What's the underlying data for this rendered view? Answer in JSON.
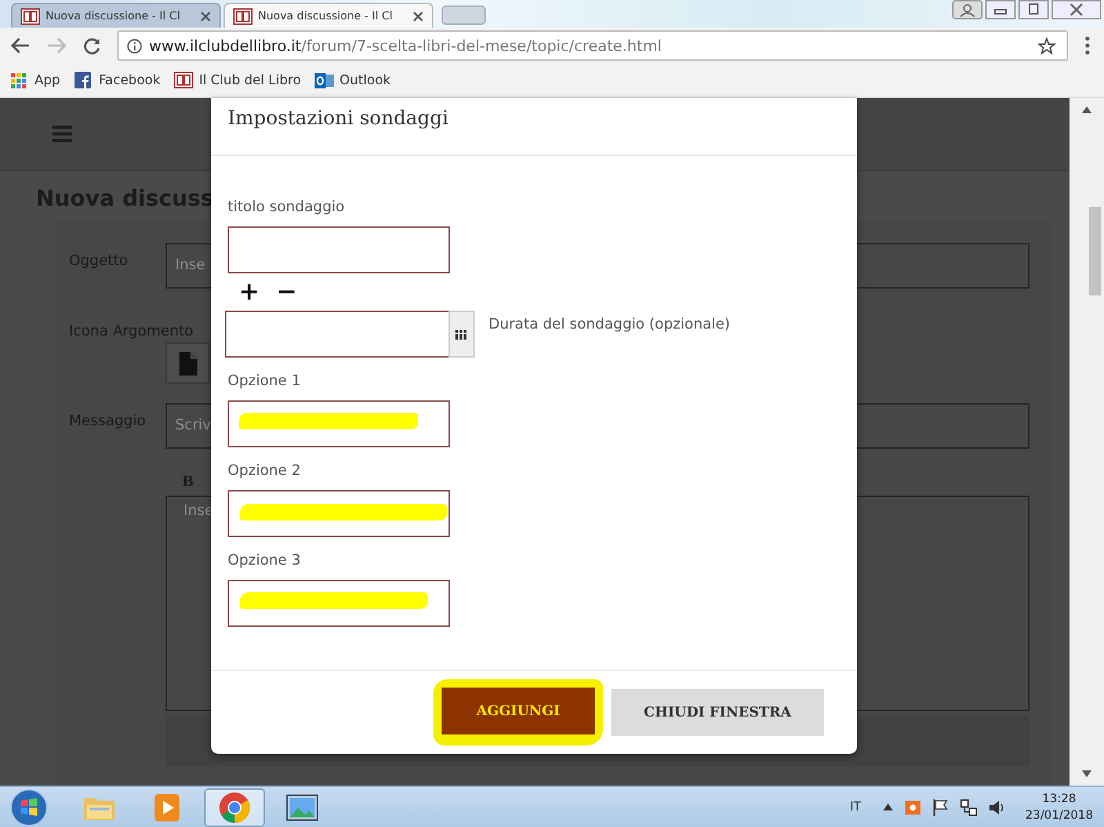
{
  "browser": {
    "tabs": [
      {
        "title": "Nuova discussione - Il Cl",
        "selected": false
      },
      {
        "title": "Nuova discussione - Il Cl",
        "selected": true
      }
    ],
    "url": {
      "host": "www.ilclubdellibro.it",
      "path": "/forum/7-scelta-libri-del-mese/topic/create.html"
    },
    "bookmarks": [
      {
        "label": "App",
        "kind": "apps"
      },
      {
        "label": "Facebook",
        "kind": "facebook"
      },
      {
        "label": "Il Club del Libro",
        "kind": "club"
      },
      {
        "label": "Outlook",
        "kind": "outlook"
      }
    ]
  },
  "page": {
    "title": "Nuova discuss",
    "fields": [
      {
        "label": "Oggetto",
        "kind": "text",
        "placeholder": "Inse"
      },
      {
        "label": "Icona Argomento",
        "kind": "icon"
      },
      {
        "label": "Messaggio",
        "kind": "text",
        "placeholder": "Scriv"
      }
    ],
    "editor": {
      "toolbar": "B",
      "placeholder": "Inse"
    }
  },
  "modal": {
    "title": "Impostazioni sondaggi",
    "title_label": "titolo sondaggio",
    "add": "+",
    "remove": "−",
    "duration_label": "Durata del sondaggio (opzionale)",
    "options": [
      {
        "label": "Opzione 1",
        "highlighted": true
      },
      {
        "label": "Opzione 2",
        "highlighted": true
      },
      {
        "label": "Opzione 3",
        "highlighted": true
      }
    ],
    "buttons": [
      {
        "label": "AGGIUNGI",
        "kind": "primary",
        "highlighted": true
      },
      {
        "label": "CHIUDI FINESTRA",
        "kind": "secondary",
        "highlighted": false
      }
    ]
  },
  "taskbar": {
    "apps": [
      {
        "kind": "folder",
        "selected": false
      },
      {
        "kind": "media",
        "selected": false
      },
      {
        "kind": "chrome",
        "selected": true
      },
      {
        "kind": "photos",
        "selected": false
      }
    ],
    "language": "IT",
    "time": "13:28",
    "date": "23/01/2018"
  }
}
